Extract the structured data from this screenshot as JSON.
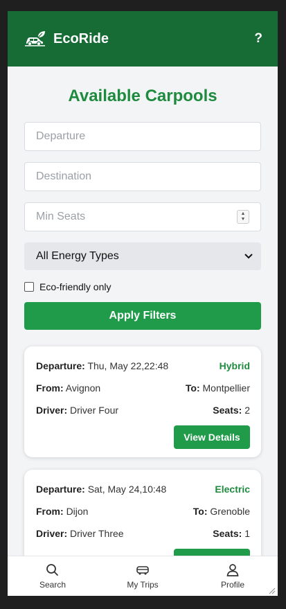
{
  "app": {
    "name": "EcoRide",
    "help_label": "?"
  },
  "page_title": "Available Carpools",
  "filters": {
    "departure_placeholder": "Departure",
    "destination_placeholder": "Destination",
    "seats_placeholder": "Min Seats",
    "energy_selected": "All Energy Types",
    "eco_label": "Eco-friendly only",
    "apply_label": "Apply Filters"
  },
  "trips": [
    {
      "departure_label": "Departure:",
      "departure": "Thu, May 22,22:48",
      "energy": "Hybrid",
      "from_label": "From:",
      "from": "Avignon",
      "to_label": "To:",
      "to": "Montpellier",
      "driver_label": "Driver:",
      "driver": "Driver Four",
      "seats_label": "Seats:",
      "seats": "2",
      "details_label": "View Details"
    },
    {
      "departure_label": "Departure:",
      "departure": "Sat, May 24,10:48",
      "energy": "Electric",
      "from_label": "From:",
      "from": "Dijon",
      "to_label": "To:",
      "to": "Grenoble",
      "driver_label": "Driver:",
      "driver": "Driver Three",
      "seats_label": "Seats:",
      "seats": "1",
      "details_label": "View Details"
    }
  ],
  "nav": [
    {
      "label": "Search",
      "icon": "search-icon"
    },
    {
      "label": "My Trips",
      "icon": "car-icon"
    },
    {
      "label": "Profile",
      "icon": "user-icon"
    }
  ],
  "colors": {
    "header": "#176b35",
    "accent": "#1f9b4a",
    "title": "#1e8a3e"
  }
}
